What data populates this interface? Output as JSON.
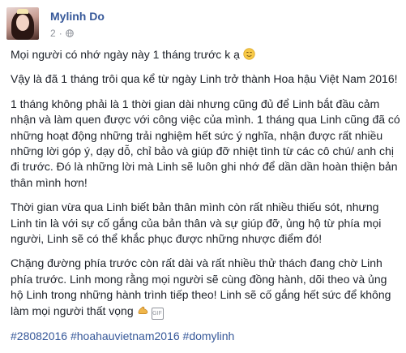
{
  "author": {
    "name": "Mylinh Do"
  },
  "meta": {
    "time": "2"
  },
  "icons": {
    "avatar": "profile-photo",
    "privacy": "globe-icon",
    "emoji_1": "smiling-relieved-emoji",
    "emoji_2": "flexed-biceps-emoji",
    "gif": "gif-icon"
  },
  "post": {
    "p1": "Mọi người có nhớ ngày này 1 tháng trước k ạ",
    "p2": "Vậy là đã 1 tháng trôi qua kể từ ngày Linh trở thành Hoa hậu Việt Nam 2016!",
    "p3": "1 tháng không phải là 1 thời gian dài nhưng cũng đủ để Linh bắt đầu cảm nhận và làm quen được với công việc của mình. 1 tháng qua Linh cũng đã có những hoạt động những trải nghiệm hết sức ý nghĩa, nhận được rất nhiều những lời góp ý, dạy dỗ, chỉ bảo và giúp đỡ nhiệt tình từ các cô chú/ anh chị đi trước. Đó là những lời mà Linh sẽ luôn ghi nhớ để dần dần hoàn thiện bản thân mình hơn!",
    "p4": "Thời gian vừa qua Linh biết bản thân mình còn rất nhiều thiếu sót, nhưng Linh tin là với sự cố gắng của bản thân và sự giúp đỡ, ủng hộ từ phía mọi người, Linh sẽ có thể khắc phục được những nhược điểm đó!",
    "p5": "Chặng đường phía trước còn rất dài và rất nhiều thử thách đang chờ Linh phía trước. Linh mong rằng mọi người sẽ cùng đồng hành, dõi theo và ủng hộ Linh trong những hành trình tiếp theo! Linh sẽ cố gắng hết sức để không làm mọi người thất vọng",
    "gif_label": "GIF"
  },
  "hashtags": [
    "#28082016",
    "#hoahauvietnam2016",
    "#domylinh"
  ]
}
